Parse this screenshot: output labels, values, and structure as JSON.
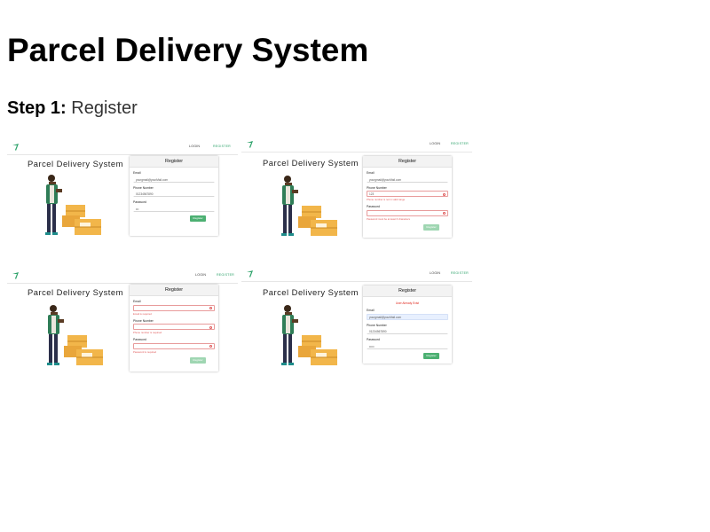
{
  "page": {
    "title": "Parcel Delivery System",
    "step_label": "Step 1:",
    "step_text": "Register"
  },
  "shot1": {
    "nav_login": "LOGIN",
    "nav_register": "REGISTER",
    "hero_title": "Parcel Delivery System",
    "card_title": "Register",
    "email_label": "Email",
    "email_value": "yourgmail@yourMail.com",
    "phone_label": "Phone Number",
    "phone_value": "01234567890",
    "password_label": "Password",
    "password_value": "•••",
    "button": "Register"
  },
  "shot2": {
    "nav_login": "LOGIN",
    "nav_register": "REGISTER",
    "hero_title": "Parcel Delivery System",
    "card_title": "Register",
    "email_label": "Email",
    "email_value": "yourgmail@yourMail.com",
    "phone_label": "Phone Number",
    "phone_value": "123",
    "phone_error": "Phone number is not in valid range",
    "password_label": "Password",
    "password_value": "",
    "password_error": "Password must be at least 6 characters",
    "button": "Register"
  },
  "shot3": {
    "nav_login": "LOGIN",
    "nav_register": "REGISTER",
    "hero_title": "Parcel Delivery System",
    "card_title": "Register",
    "email_label": "Email",
    "email_value": "",
    "email_error": "Email is required",
    "phone_label": "Phone Number",
    "phone_value": "",
    "phone_error": "Phone number is required",
    "password_label": "Password",
    "password_value": "",
    "password_error": "Password is required",
    "button": "Register"
  },
  "shot4": {
    "nav_login": "LOGIN",
    "nav_register": "REGISTER",
    "hero_title": "Parcel Delivery System",
    "card_title": "Register",
    "alert": "User Already Exist",
    "email_label": "Email",
    "email_value": "yourgmail@yourMail.com",
    "phone_label": "Phone Number",
    "phone_value": "01234567890",
    "password_label": "Password",
    "password_value": "•••••",
    "button": "Register"
  },
  "colors": {
    "accent_green": "#4cb072",
    "error_red": "#e05a5a",
    "alert_red": "#e0281e"
  },
  "icons": {
    "logo": "leaf-logo-icon",
    "input_error": "error-circle-icon",
    "illustration": "delivery-man-with-parcels"
  }
}
